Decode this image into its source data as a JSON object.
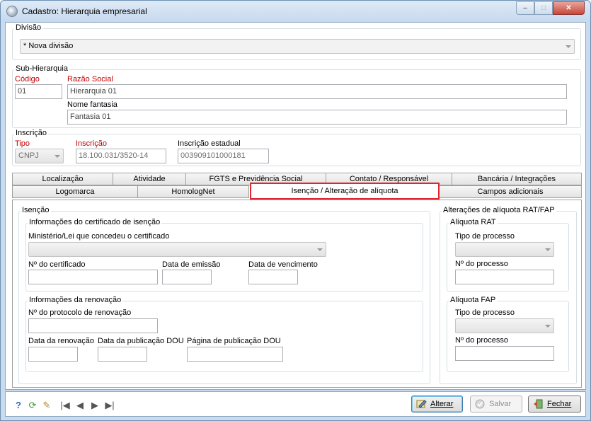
{
  "window": {
    "title": "Cadastro: Hierarquia empresarial",
    "minimize": "–",
    "maximize": "□",
    "close": "✕"
  },
  "divisao": {
    "legend": "Divisão",
    "value": "* Nova divisão"
  },
  "subhierarquia": {
    "legend": "Sub-Hierarquia",
    "codigo_label": "Código",
    "codigo_value": "01",
    "razao_label": "Razão Social",
    "razao_value": "Hierarquia 01",
    "fantasia_label": "Nome fantasia",
    "fantasia_value": "Fantasia 01"
  },
  "inscricao": {
    "legend": "Inscrição",
    "tipo_label": "Tipo",
    "tipo_value": "CNPJ",
    "inscricao_label": "Inscrição",
    "inscricao_value": "18.100.031/3520-14",
    "estadual_label": "Inscrição estadual",
    "estadual_value": "003909101000181"
  },
  "tabs": {
    "row1": [
      "Localização",
      "Atividade",
      "FGTS e Previdência Social",
      "Contato / Responsável",
      "Bancária / Integrações"
    ],
    "row2": [
      "Logomarca",
      "HomologNet",
      "Isenção / Alteração de alíquota",
      "Campos adicionais"
    ]
  },
  "isencao": {
    "legend": "Isenção",
    "certificado": {
      "legend": "Informações do certificado de isenção",
      "ministerio_label": "Ministério/Lei que concedeu o certificado",
      "numero_label": "Nº do certificado",
      "emissao_label": "Data de emissão",
      "vencimento_label": "Data de vencimento"
    },
    "renovacao": {
      "legend": "Informações da renovação",
      "protocolo_label": "Nº do protocolo de renovação",
      "data_renovacao_label": "Data da renovação",
      "data_publicacao_label": "Data da publicação DOU",
      "pagina_label": "Página de publicação DOU"
    }
  },
  "aliquota": {
    "legend": "Alterações de alíquota RAT/FAP",
    "rat": {
      "legend": "Alíquota RAT",
      "tipo_label": "Tipo de processo",
      "numero_label": "Nº do processo"
    },
    "fap": {
      "legend": "Alíquota FAP",
      "tipo_label": "Tipo de processo",
      "numero_label": "Nº do processo"
    }
  },
  "footer": {
    "alterar": "Alterar",
    "salvar": "Salvar",
    "fechar": "Fechar",
    "nav": {
      "first": "|◀",
      "prev": "◀",
      "next": "▶",
      "last": "▶|"
    }
  }
}
